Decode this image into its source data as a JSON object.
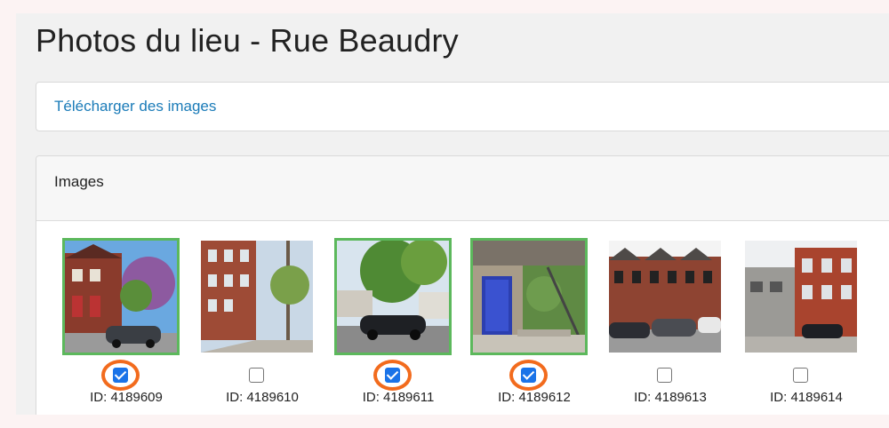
{
  "page": {
    "title": "Photos du lieu - Rue Beaudry"
  },
  "upload": {
    "link_label": "Télécharger des images"
  },
  "images_section": {
    "title": "Images",
    "items": [
      {
        "id_label": "ID: 4189609",
        "checked": true,
        "selected": true,
        "highlighted": true,
        "scene": "brick-house-tree-car"
      },
      {
        "id_label": "ID: 4189610",
        "checked": false,
        "selected": false,
        "highlighted": false,
        "scene": "street-brick-building-trees"
      },
      {
        "id_label": "ID: 4189611",
        "checked": true,
        "selected": true,
        "highlighted": true,
        "scene": "street-tree-black-car"
      },
      {
        "id_label": "ID: 4189612",
        "checked": true,
        "selected": true,
        "highlighted": true,
        "scene": "blue-door-ivy-stairs"
      },
      {
        "id_label": "ID: 4189613",
        "checked": false,
        "selected": false,
        "highlighted": false,
        "scene": "rowhouses-parked-cars"
      },
      {
        "id_label": "ID: 4189614",
        "checked": false,
        "selected": false,
        "highlighted": false,
        "scene": "grey-red-buildings-balconies"
      }
    ]
  },
  "colors": {
    "selected_border": "#5cb85c",
    "highlight_ring": "#f26b1d",
    "checkbox_checked": "#1a73e8",
    "link": "#1a7bb8"
  }
}
